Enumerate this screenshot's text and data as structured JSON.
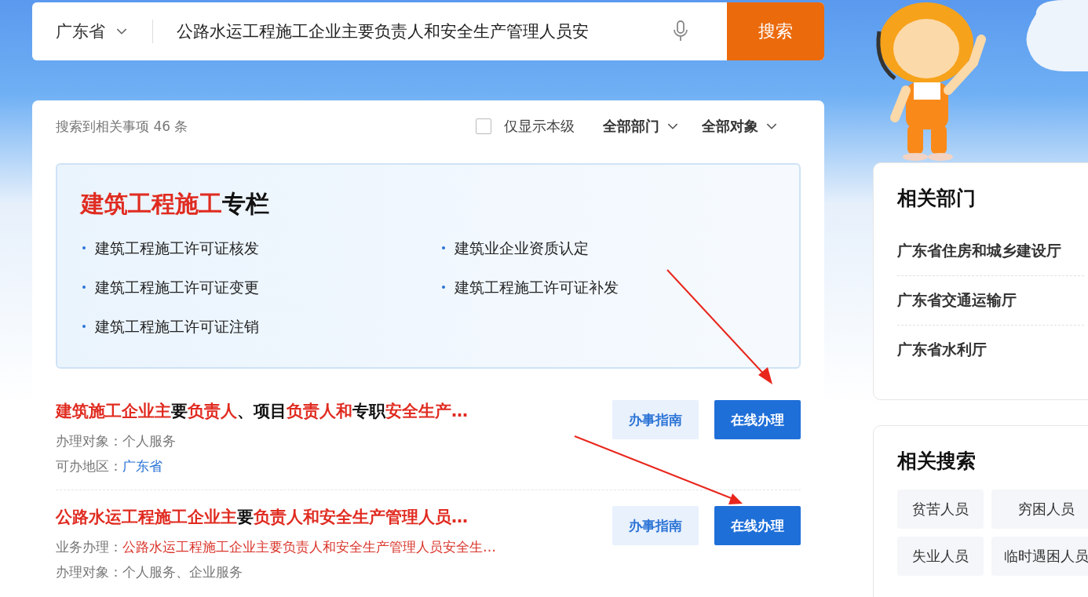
{
  "search": {
    "region": "广东省",
    "query": "公路水运工程施工企业主要负责人和安全生产管理人员安",
    "button": "搜索"
  },
  "filters": {
    "count_text": "搜索到相关事项 46 条",
    "only_this_level": {
      "label": "仅显示本级",
      "checked": false
    },
    "dropdowns": [
      "全部部门",
      "全部对象"
    ]
  },
  "column": {
    "title": [
      {
        "text": "建筑工程施工",
        "highlight": true
      },
      {
        "text": "专栏",
        "highlight": false
      }
    ],
    "items": [
      "建筑工程施工许可证核发",
      "建筑业企业资质认定",
      "建筑工程施工许可证变更",
      "建筑工程施工许可证补发",
      "建筑工程施工许可证注销"
    ]
  },
  "results": [
    {
      "title": [
        {
          "text": "建筑施工企业主",
          "highlight": true
        },
        {
          "text": "要",
          "highlight": false
        },
        {
          "text": "负责人",
          "highlight": true
        },
        {
          "text": "、项目",
          "highlight": false
        },
        {
          "text": "负责人和",
          "highlight": true
        },
        {
          "text": "专职",
          "highlight": false
        },
        {
          "text": "安全生产…",
          "highlight": true
        }
      ],
      "fields": [
        {
          "label": "办理对象：",
          "value": "个人服务",
          "kind": "plain"
        },
        {
          "label": "可办地区：",
          "value": "广东省",
          "kind": "link"
        }
      ],
      "buttons": [
        "办事指南",
        "在线办理"
      ]
    },
    {
      "title": [
        {
          "text": "公路水运工程施工企业主",
          "highlight": true
        },
        {
          "text": "要",
          "highlight": false
        },
        {
          "text": "负责人和安全生产管理人员…",
          "highlight": true
        }
      ],
      "fields": [
        {
          "label": "业务办理：",
          "value": "公路水运工程施工企业主要负责人和安全生产管理人员安全生…",
          "kind": "highlight"
        },
        {
          "label": "办理对象：",
          "value": "个人服务、企业服务",
          "kind": "plain"
        }
      ],
      "buttons": [
        "办事指南",
        "在线办理"
      ]
    }
  ],
  "related_departments": {
    "title": "相关部门",
    "items": [
      "广东省住房和城乡建设厅",
      "广东省交通运输厅",
      "广东省水利厅"
    ]
  },
  "related_searches": {
    "title": "相关搜索",
    "tags": [
      "贫苦人员",
      "穷困人员",
      "失业人员",
      "临时遇困人员"
    ]
  }
}
